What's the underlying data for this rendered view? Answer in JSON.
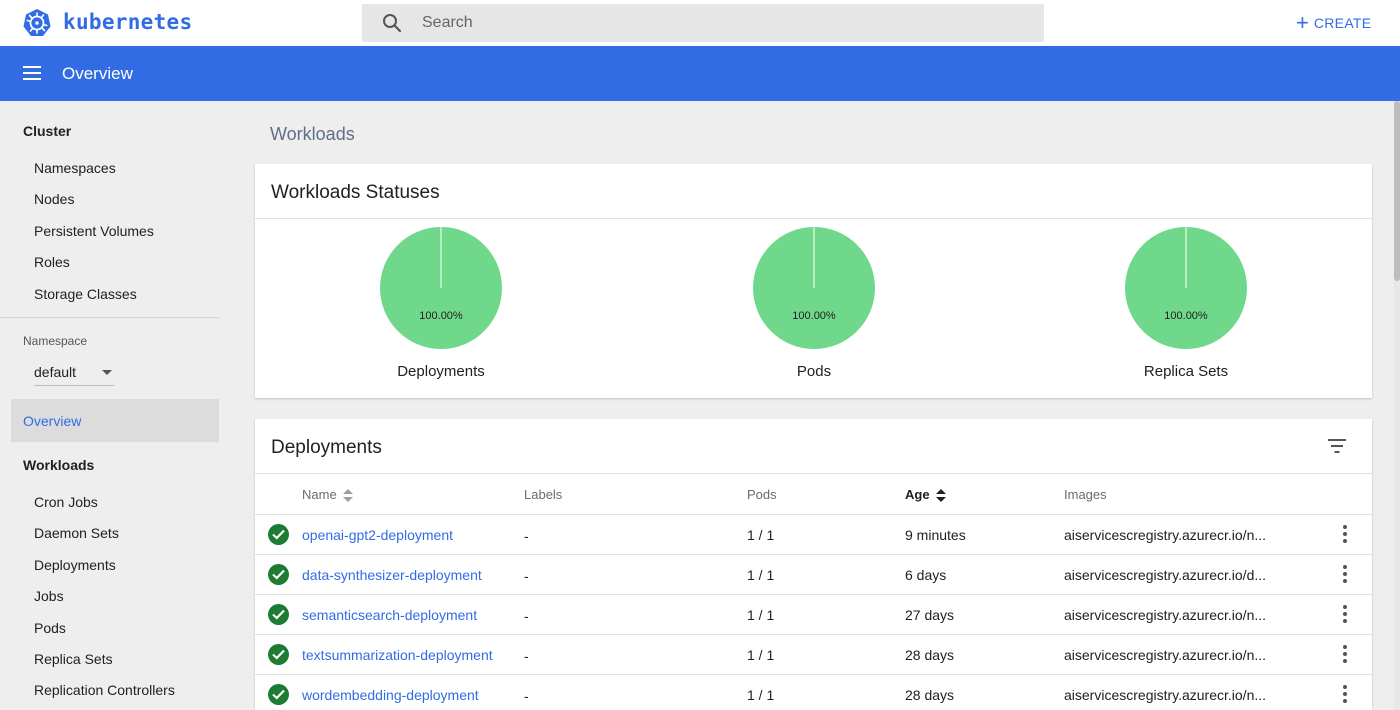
{
  "header": {
    "brand": "kubernetes",
    "search_placeholder": "Search",
    "create_label": "CREATE"
  },
  "toolbar": {
    "title": "Overview"
  },
  "sidebar": {
    "cluster_heading": "Cluster",
    "cluster_items": [
      "Namespaces",
      "Nodes",
      "Persistent Volumes",
      "Roles",
      "Storage Classes"
    ],
    "namespace_label": "Namespace",
    "namespace_value": "default",
    "overview_label": "Overview",
    "workloads_heading": "Workloads",
    "workloads_items": [
      "Cron Jobs",
      "Daemon Sets",
      "Deployments",
      "Jobs",
      "Pods",
      "Replica Sets",
      "Replication Controllers"
    ]
  },
  "main": {
    "title": "Workloads",
    "statuses": {
      "title": "Workloads Statuses",
      "charts": [
        {
          "label": "Deployments",
          "percent_label": "100.00%",
          "running": 100
        },
        {
          "label": "Pods",
          "percent_label": "100.00%",
          "running": 100
        },
        {
          "label": "Replica Sets",
          "percent_label": "100.00%",
          "running": 100
        }
      ],
      "pie_color": "#6fd88b"
    },
    "deployments": {
      "title": "Deployments",
      "columns": [
        "Name",
        "Labels",
        "Pods",
        "Age",
        "Images"
      ],
      "rows": [
        {
          "name": "openai-gpt2-deployment",
          "labels": "-",
          "pods": "1 / 1",
          "age": "9 minutes",
          "images": "aiservicescregistry.azurecr.io/n..."
        },
        {
          "name": "data-synthesizer-deployment",
          "labels": "-",
          "pods": "1 / 1",
          "age": "6 days",
          "images": "aiservicescregistry.azurecr.io/d..."
        },
        {
          "name": "semanticsearch-deployment",
          "labels": "-",
          "pods": "1 / 1",
          "age": "27 days",
          "images": "aiservicescregistry.azurecr.io/n..."
        },
        {
          "name": "textsummarization-deployment",
          "labels": "-",
          "pods": "1 / 1",
          "age": "28 days",
          "images": "aiservicescregistry.azurecr.io/n..."
        },
        {
          "name": "wordembedding-deployment",
          "labels": "-",
          "pods": "1 / 1",
          "age": "28 days",
          "images": "aiservicescregistry.azurecr.io/n..."
        }
      ]
    }
  },
  "colors": {
    "accent": "#326ce5",
    "status_ok": "#1e7b34"
  }
}
